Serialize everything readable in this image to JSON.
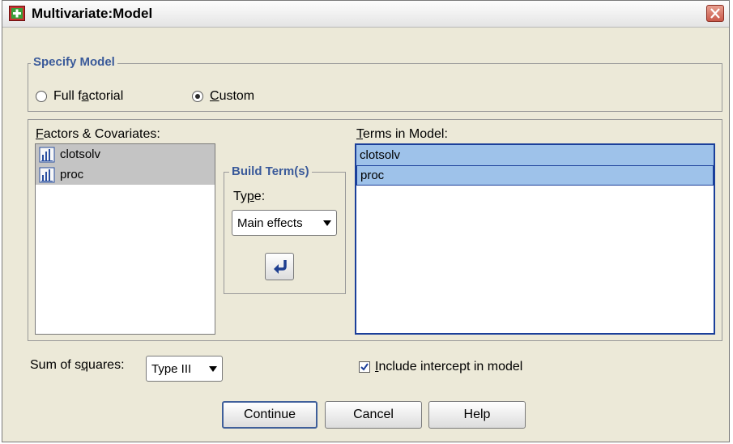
{
  "window": {
    "title": "Multivariate:Model",
    "icon": "spss-model-icon",
    "close_icon": "close-icon"
  },
  "specify_model": {
    "legend": "Specify Model",
    "options": [
      {
        "label": "Full factorial",
        "selected": false
      },
      {
        "label": "Custom",
        "selected": true
      }
    ]
  },
  "factors": {
    "label": "Factors & Covariates:",
    "items": [
      {
        "label": "clotsolv",
        "icon": "scale-variable-icon"
      },
      {
        "label": "proc",
        "icon": "scale-variable-icon"
      }
    ]
  },
  "build_term": {
    "legend": "Build Term(s)",
    "type_label": "Type:",
    "type_value": "Main effects",
    "add_icon": "arrow-right-icon"
  },
  "terms": {
    "label": "Terms in Model:",
    "items": [
      {
        "label": "clotsolv"
      },
      {
        "label": "proc"
      }
    ]
  },
  "sum_of_squares": {
    "label": "Sum of squares:",
    "value": "Type III"
  },
  "include_intercept": {
    "label": "Include intercept in model",
    "checked": true
  },
  "buttons": {
    "continue": "Continue",
    "cancel": "Cancel",
    "help": "Help"
  },
  "colors": {
    "legend_text": "#3a5a9a",
    "selection": "#9ec2ea",
    "factor_selection": "#c4c4c4"
  }
}
